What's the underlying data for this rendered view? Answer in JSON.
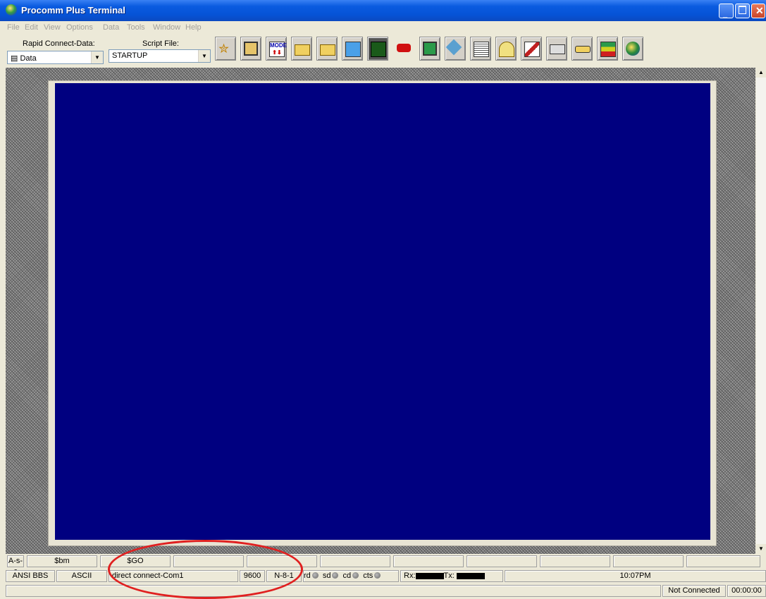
{
  "window": {
    "title": "Procomm Plus Terminal"
  },
  "menu": [
    "File",
    "Edit",
    "View",
    "Options",
    "Data",
    "Tools",
    "Window",
    "Help"
  ],
  "toolbar": {
    "rapid_connect_label": "Rapid Connect-Data:",
    "rapid_connect_value": "Data",
    "script_file_label": "Script File:",
    "script_file_value": "STARTUP",
    "button_mode_text": "MODE",
    "buttons": [
      "run-icon",
      "phonebook-icon",
      "mode-icon",
      "send-file-icon",
      "receive-file-icon",
      "fax-icon",
      "terminal-icon",
      "hangup-icon",
      "monitor-icon",
      "tools-icon",
      "capture-icon",
      "filter-icon",
      "setup-icon",
      "printer-icon",
      "keyboard-icon",
      "meta-keys-icon",
      "internet-icon"
    ]
  },
  "statusbar": {
    "meta_keys": [
      "A-s-c",
      "$bm",
      "$GO",
      "",
      "",
      "",
      "",
      "",
      "",
      "",
      ""
    ],
    "emulation": "ANSI BBS",
    "transfer": "ASCII",
    "connection": "direct connect-Com1",
    "baud": "9600",
    "parity": "N-8-1",
    "indicators": [
      "rd",
      "sd",
      "cd",
      "cts"
    ],
    "rx_label": "Rx:",
    "tx_label": "Tx:",
    "clock": "10:07PM",
    "status": "Not Connected",
    "timer": "00:00:00"
  },
  "colors": {
    "terminal_bg": "#000080",
    "annotation": "#e02020"
  }
}
